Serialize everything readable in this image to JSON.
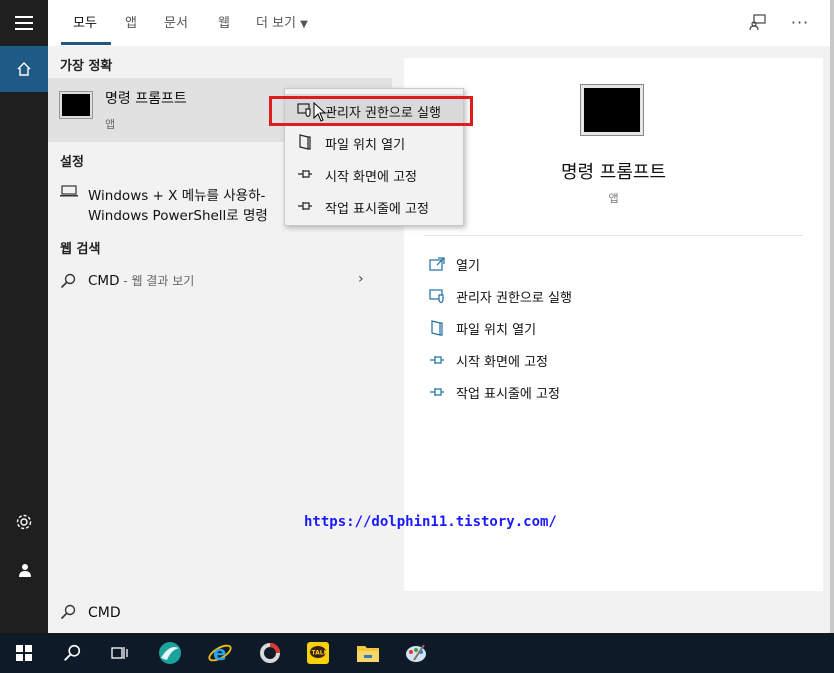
{
  "tabs": [
    {
      "label": "모두"
    },
    {
      "label": "앱"
    },
    {
      "label": "문서"
    },
    {
      "label": "웹"
    },
    {
      "label": "더 보기"
    }
  ],
  "left": {
    "best_match_header": "가장 정확",
    "best_match": {
      "title": "명령 프롬프트",
      "subtitle": "앱"
    },
    "settings_header": "설정",
    "settings_line1": "Windows + X 메뉴를 사용하-",
    "settings_line2": "Windows PowerShell로 명령",
    "web_header": "웹 검색",
    "web_query": "CMD",
    "web_hint": " - 웹 결과 보기"
  },
  "context_menu": {
    "items": [
      {
        "label": "관리자 권한으로 실행"
      },
      {
        "label": "파일 위치 열기"
      },
      {
        "label": "시작 화면에 고정"
      },
      {
        "label": "작업 표시줄에 고정"
      }
    ]
  },
  "preview": {
    "title": "명령 프롬프트",
    "subtitle": "앱",
    "actions": [
      {
        "label": "열기"
      },
      {
        "label": "관리자 권한으로 실행"
      },
      {
        "label": "파일 위치 열기"
      },
      {
        "label": "시작 화면에 고정"
      },
      {
        "label": "작업 표시줄에 고정"
      }
    ]
  },
  "search": {
    "value": "CMD"
  },
  "watermark": "https://dolphin11.tistory.com/",
  "colors": {
    "accent": "#1f5a86",
    "rail": "#1f1f1f",
    "taskbar": "#0f1a28",
    "highlight_box": "#e01b1b",
    "icon_blue": "#1f6fa3"
  }
}
